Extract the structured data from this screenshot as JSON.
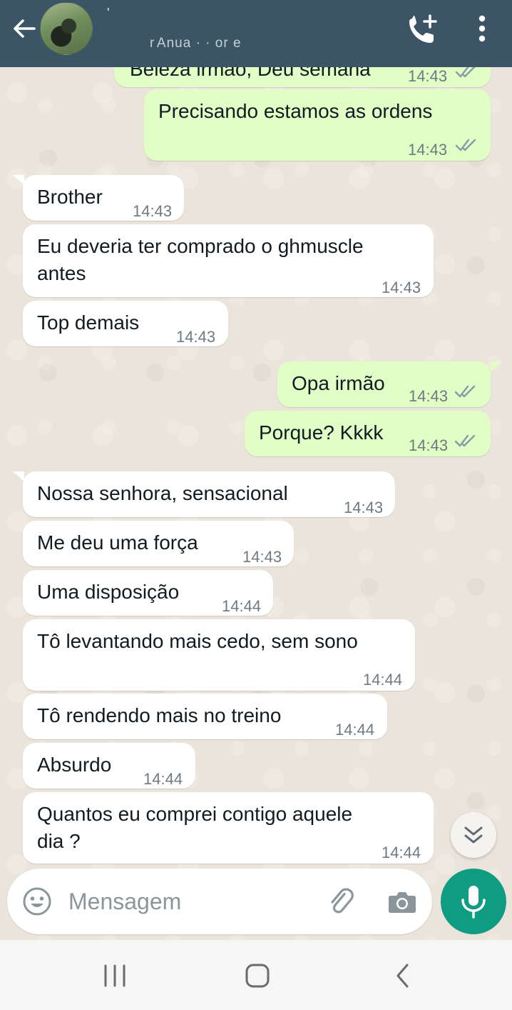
{
  "header": {
    "contact_name": "'",
    "contact_status": "r Anua · ·  or  e"
  },
  "messages": [
    {
      "dir": "out",
      "text": "Beleza irmão, Deu semana",
      "time": "14:43"
    },
    {
      "dir": "out",
      "text": "Precisando estamos as ordens",
      "time": "14:43"
    },
    {
      "dir": "in",
      "text": "Brother",
      "time": "14:43"
    },
    {
      "dir": "in",
      "text": "Eu deveria ter comprado o ghmuscle",
      "text2": "antes",
      "time": "14:43"
    },
    {
      "dir": "in",
      "text": "Top demais",
      "time": "14:43"
    },
    {
      "dir": "out",
      "text": "Opa irmão",
      "time": "14:43"
    },
    {
      "dir": "out",
      "text": "Porque? Kkkk",
      "time": "14:43"
    },
    {
      "dir": "in",
      "text": "Nossa senhora, sensacional",
      "time": "14:43"
    },
    {
      "dir": "in",
      "text": "Me deu uma força",
      "time": "14:43"
    },
    {
      "dir": "in",
      "text": "Uma disposição",
      "time": "14:44"
    },
    {
      "dir": "in",
      "text": "Tô levantando mais cedo, sem sono",
      "time": "14:44"
    },
    {
      "dir": "in",
      "text": "Tô rendendo mais no treino",
      "time": "14:44"
    },
    {
      "dir": "in",
      "text": "Absurdo",
      "time": "14:44"
    },
    {
      "dir": "in",
      "text": "Quantos eu comprei contigo aquele",
      "text2": "dia ?",
      "time": "14:44"
    }
  ],
  "composer": {
    "placeholder": "Mensagem"
  },
  "icons": {
    "back": "arrow-left-icon",
    "call": "add-call-icon",
    "menu": "more-vert-icon",
    "emoji": "emoji-icon",
    "attach": "paperclip-icon",
    "camera": "camera-icon",
    "mic": "mic-icon",
    "scroll": "double-chevron-down-icon"
  },
  "colors": {
    "header": "#3b5466",
    "incoming_bubble": "#ffffff",
    "outgoing_bubble": "#e1fec6",
    "accent": "#0e9c82",
    "read_ticks": "#8a9aa3"
  }
}
